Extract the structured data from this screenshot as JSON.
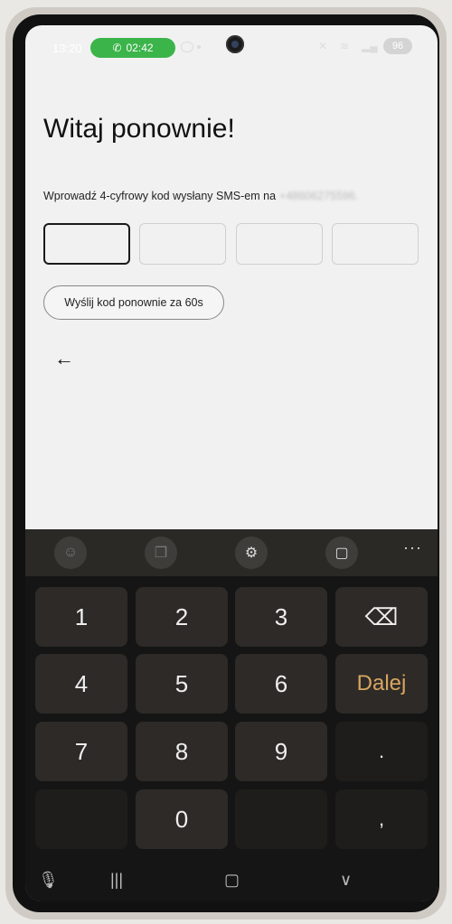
{
  "status_bar": {
    "time": "13:20",
    "call_duration": "02:42",
    "battery": "96"
  },
  "login": {
    "title": "Witaj ponownie!",
    "instruction": "Wprowadź 4-cyfrowy kod wysłany SMS-em na",
    "phone_masked": "+48606275596.",
    "code_digits": [
      "",
      "",
      "",
      ""
    ],
    "resend_label": "Wyślij kod ponownie za 60s"
  },
  "keyboard": {
    "toolbar_icons": [
      "emoji-icon",
      "sticker-icon",
      "settings-icon",
      "clipboard-icon",
      "more-icon"
    ],
    "more_label": "···",
    "keys": [
      "1",
      "2",
      "3",
      "⌫",
      "4",
      "5",
      "6",
      "Dalej",
      "7",
      "8",
      "9",
      ".",
      "",
      "0",
      "",
      ","
    ]
  },
  "navbar": {
    "icons": [
      "microphone-icon",
      "recent-apps-icon",
      "home-icon",
      "hide-keyboard-icon"
    ]
  },
  "colors": {
    "call_pill": "#3bb44a",
    "enter_key": "#d8a560",
    "keyboard_bg": "#151515"
  }
}
